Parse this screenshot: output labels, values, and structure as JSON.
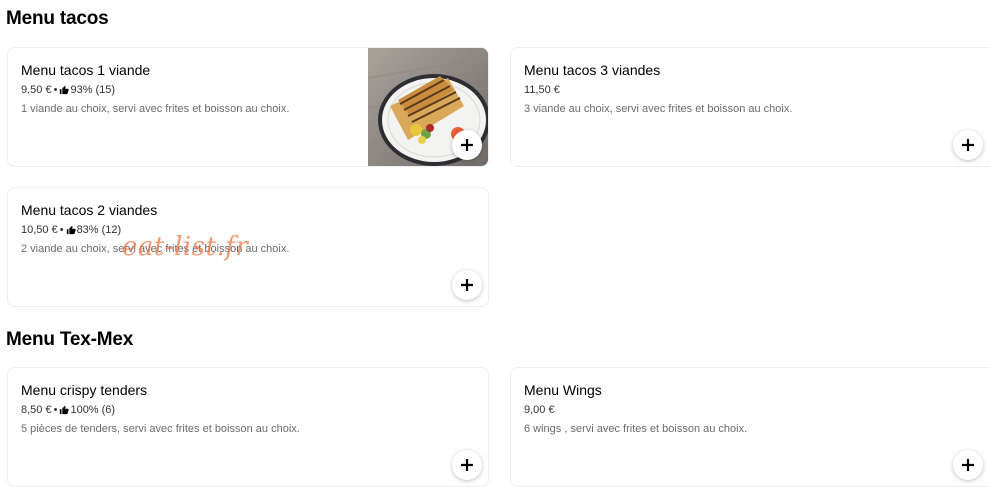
{
  "sections": [
    {
      "title": "Menu tacos",
      "items": [
        {
          "name": "Menu tacos 1 viande",
          "price": "9,50 €",
          "separator": "•",
          "rating": "93% (15)",
          "description": "1 viande au choix, servi avec frites et boisson au choix.",
          "has_image": true
        },
        {
          "name": "Menu tacos 3 viandes",
          "price": "11,50 €",
          "separator": "",
          "rating": "",
          "description": "3 viande au choix, servi avec frites et boisson au choix.",
          "has_image": false
        },
        {
          "name": "Menu tacos 2 viandes",
          "price": "10,50 €",
          "separator": "•",
          "rating": "83% (12)",
          "description": "2 viande au choix, servi avec frites et boisson au choix.",
          "has_image": false
        }
      ]
    },
    {
      "title": "Menu Tex-Mex",
      "items": [
        {
          "name": "Menu crispy tenders",
          "price": "8,50 €",
          "separator": "•",
          "rating": "100% (6)",
          "description": "5 pièces de tenders, servi avec frites et boisson au choix.",
          "has_image": false
        },
        {
          "name": "Menu Wings",
          "price": "9,00 €",
          "separator": "",
          "rating": "",
          "description": "6 wings , servi avec frites et boisson au choix.",
          "has_image": false
        }
      ]
    }
  ],
  "watermark": "eat-list.fr",
  "icons": {
    "thumb": "thumbs-up-icon",
    "add": "plus-icon"
  },
  "colors": {
    "card_border": "#eeeeee",
    "description": "#6b6b6b",
    "watermark": "#eb7846"
  }
}
